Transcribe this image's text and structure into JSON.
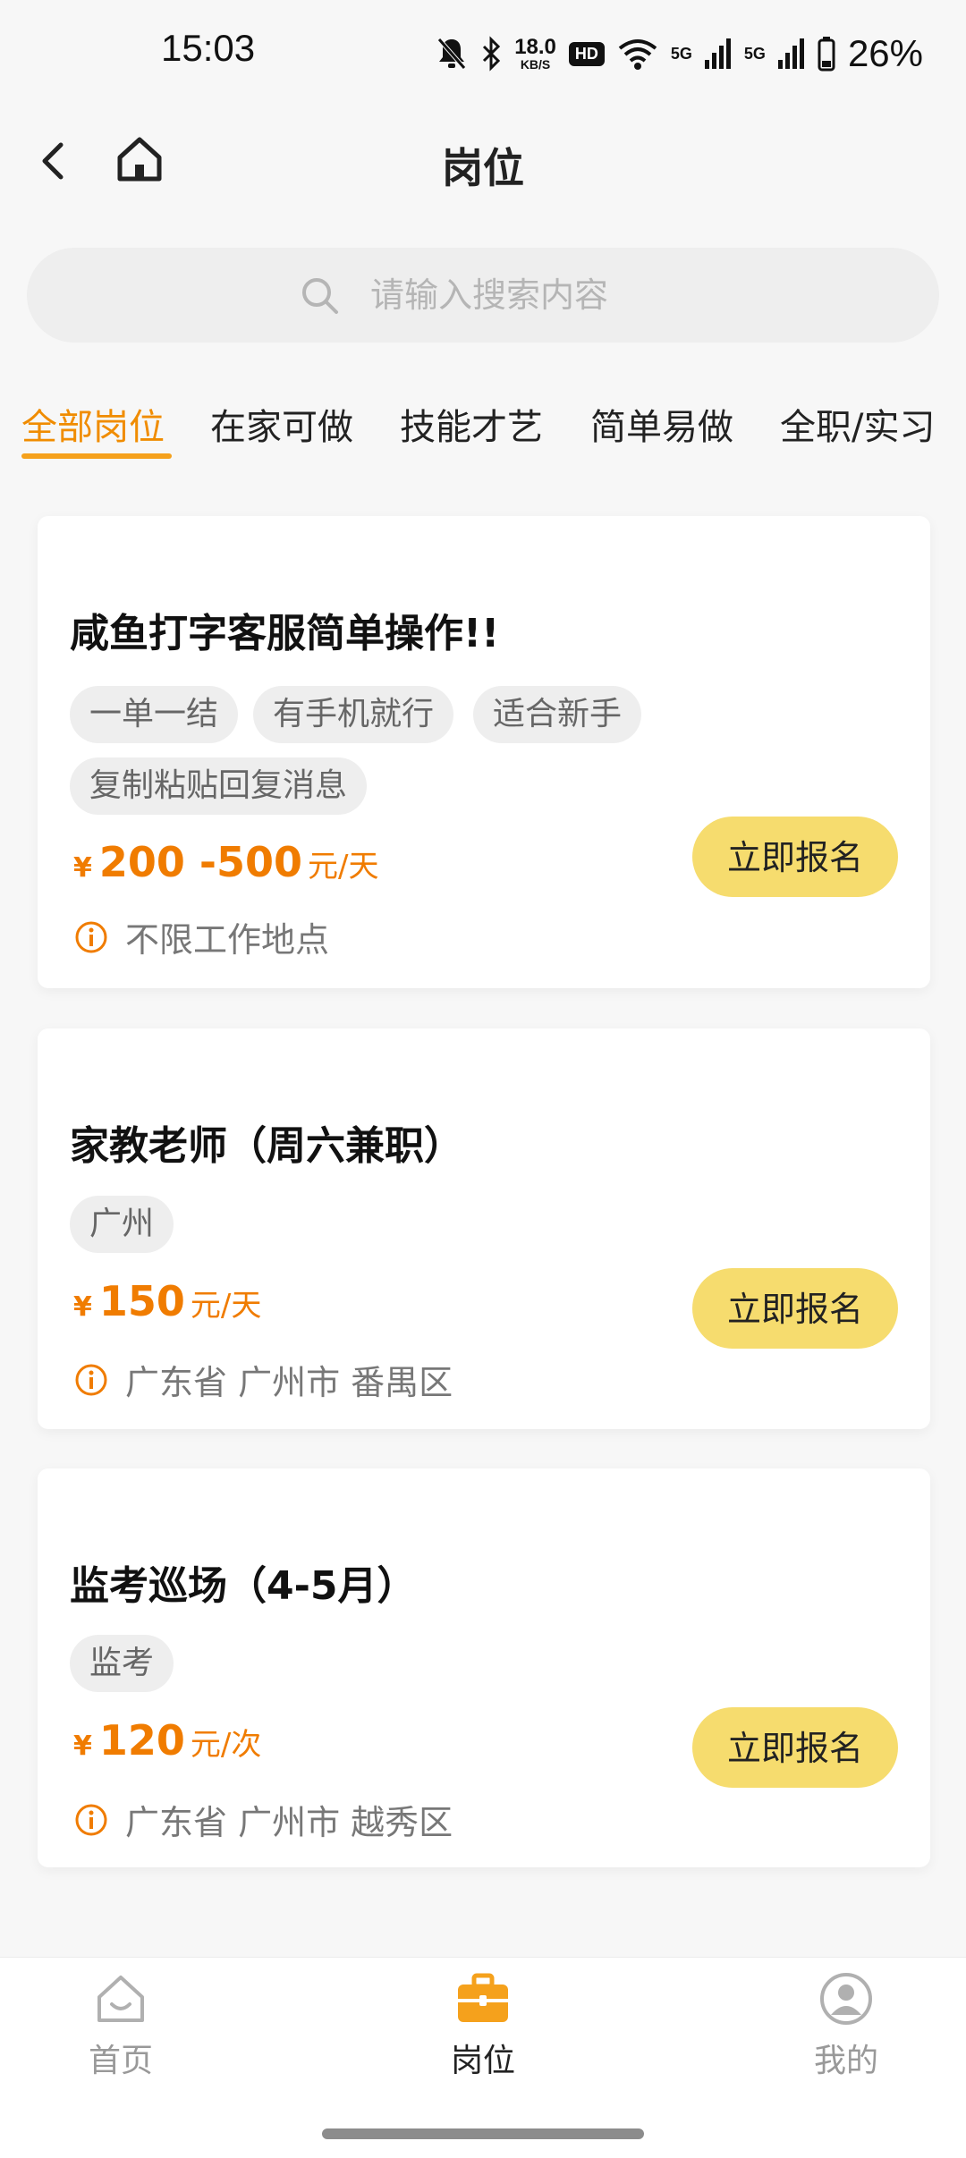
{
  "status_bar": {
    "time": "15:03",
    "net_speed_value": "18.0",
    "net_speed_unit": "KB/S",
    "hd_badge": "HD",
    "signal_1": "5G",
    "signal_2": "5G",
    "battery": "26%"
  },
  "header": {
    "title": "岗位"
  },
  "search": {
    "placeholder": "请输入搜索内容"
  },
  "tabs": [
    {
      "label": "全部岗位",
      "active": true
    },
    {
      "label": "在家可做",
      "active": false
    },
    {
      "label": "技能才艺",
      "active": false
    },
    {
      "label": "简单易做",
      "active": false
    },
    {
      "label": "全职/实习",
      "active": false
    }
  ],
  "jobs": [
    {
      "title": "咸鱼打字客服简单操作!!",
      "tags": [
        "一单一结",
        "有手机就行",
        "适合新手",
        "复制粘贴回复消息"
      ],
      "currency": "¥",
      "price": "200 -500",
      "unit": "元/天",
      "location": "不限工作地点",
      "button": "立即报名"
    },
    {
      "title": "家教老师（周六兼职）",
      "tags": [
        "广州"
      ],
      "currency": "¥",
      "price": "150",
      "unit": "元/天",
      "location": "广东省 广州市 番禺区",
      "button": "立即报名"
    },
    {
      "title": "监考巡场（4-5月）",
      "tags": [
        "监考"
      ],
      "currency": "¥",
      "price": "120",
      "unit": "元/次",
      "location": "广东省 广州市 越秀区",
      "button": "立即报名"
    }
  ],
  "bottom_nav": [
    {
      "label": "首页",
      "icon": "home-smile-icon",
      "active": false
    },
    {
      "label": "岗位",
      "icon": "briefcase-icon",
      "active": true
    },
    {
      "label": "我的",
      "icon": "user-circle-icon",
      "active": false
    }
  ],
  "colors": {
    "accent": "#f08c00",
    "price": "#f07c00",
    "button": "#f6dc6e",
    "tag_bg": "#eeeeee"
  }
}
